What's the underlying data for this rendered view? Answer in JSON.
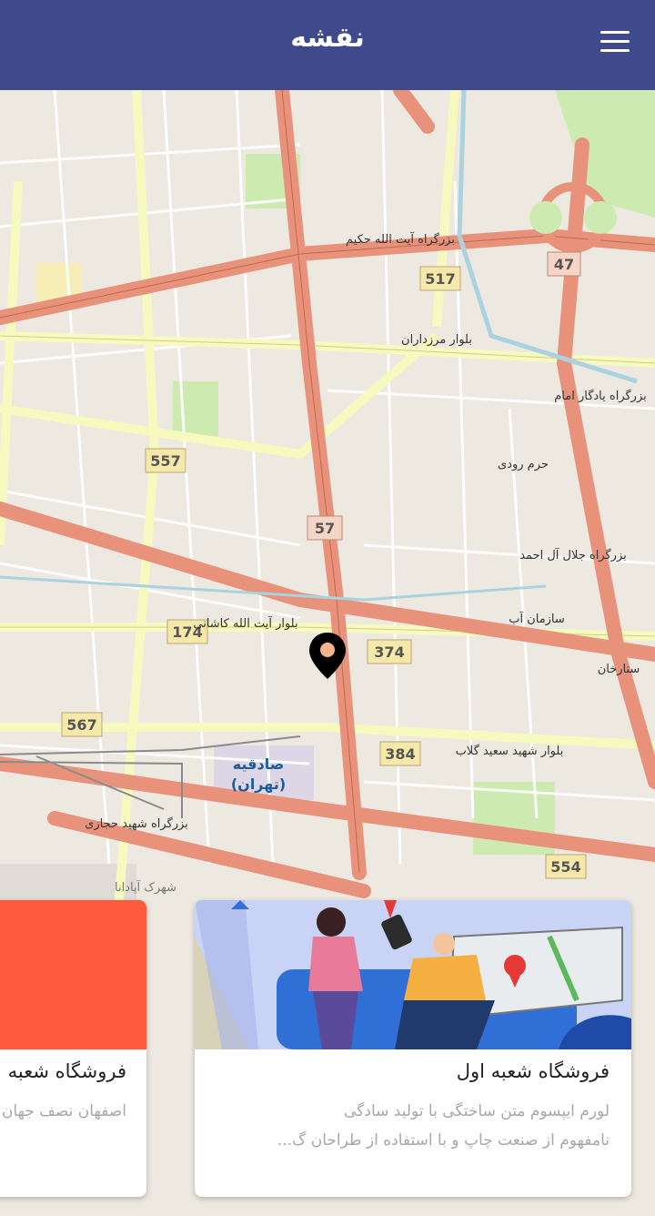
{
  "header": {
    "title": "نقشه"
  },
  "map": {
    "street_labels": [
      "بزرگراه آیت الله حکیم",
      "بلوار مرزداران",
      "حرم رودی",
      "بزرگراه جلال آل احمد",
      "سازمان آب",
      "بلوار آیت الله کاشانی",
      "بلوار شهید سعید گلاب",
      "بزرگراه شهید حجازی",
      "صادقیه",
      "(تهران)",
      "بزرگراه یادگار امام",
      "شهرک آپادانا",
      "ستارخان"
    ],
    "road_shields": [
      "517",
      "47",
      "557",
      "57",
      "174",
      "374",
      "567",
      "384",
      "554"
    ]
  },
  "cards": [
    {
      "title": "فروشگاه شعبه اول",
      "desc_line1": "لورم ایپسوم متن ساختگی با تولید سادگی",
      "desc_line2": "نامفهوم از صنعت چاپ و با استفاده از طراحان گ..."
    },
    {
      "title": "فروشگاه شعبه",
      "desc_line1": "اصفهان نصف جهان"
    }
  ],
  "colors": {
    "appbar": "#3f4a8c",
    "highway": "#e8927c",
    "primary_road": "#f7fabf",
    "park": "#cdebb0",
    "card_red": "#ff5a3d"
  }
}
